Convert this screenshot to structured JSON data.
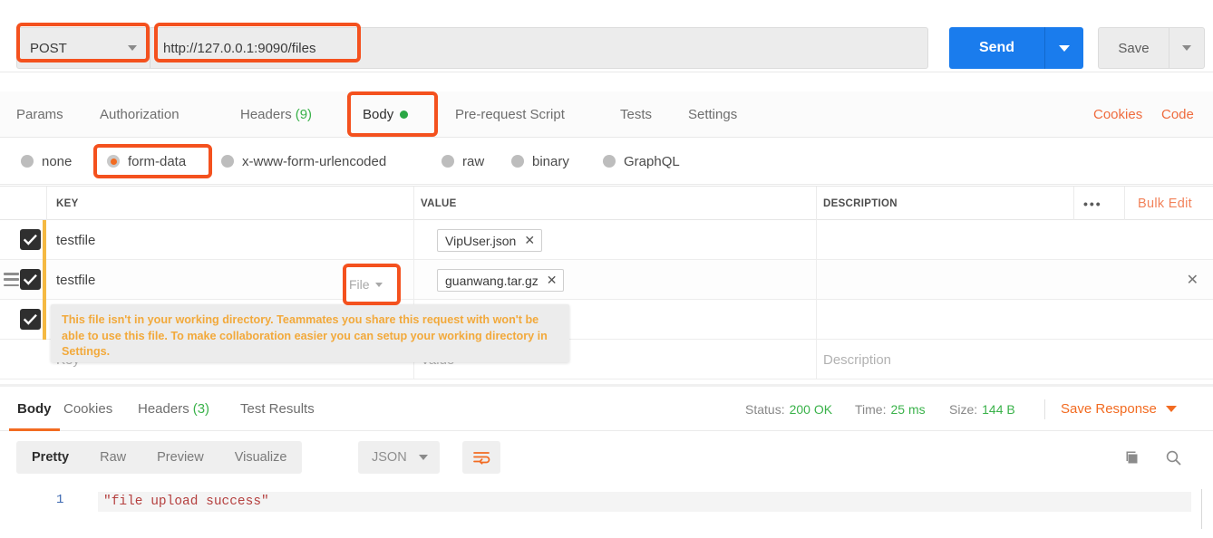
{
  "request": {
    "method": "POST",
    "url": "http://127.0.0.1:9090/files",
    "send_label": "Send",
    "save_label": "Save",
    "tabs": [
      {
        "label": "Params",
        "count": "",
        "active": false,
        "dot": false
      },
      {
        "label": "Authorization",
        "count": "",
        "active": false,
        "dot": false
      },
      {
        "label": "Headers",
        "count": "(9)",
        "active": false,
        "dot": false
      },
      {
        "label": "Body",
        "count": "",
        "active": true,
        "dot": true
      },
      {
        "label": "Pre-request Script",
        "count": "",
        "active": false,
        "dot": false
      },
      {
        "label": "Tests",
        "count": "",
        "active": false,
        "dot": false
      },
      {
        "label": "Settings",
        "count": "",
        "active": false,
        "dot": false
      }
    ],
    "cookies_label": "Cookies",
    "code_label": "Code",
    "body_types": [
      {
        "label": "none",
        "selected": false
      },
      {
        "label": "form-data",
        "selected": true
      },
      {
        "label": "x-www-form-urlencoded",
        "selected": false
      },
      {
        "label": "raw",
        "selected": false
      },
      {
        "label": "binary",
        "selected": false
      },
      {
        "label": "GraphQL",
        "selected": false
      }
    ]
  },
  "table": {
    "headers": {
      "key": "KEY",
      "value": "VALUE",
      "description": "DESCRIPTION",
      "more": "•••",
      "bulk_edit": "Bulk Edit"
    },
    "rows": [
      {
        "checked": true,
        "key": "testfile",
        "type_label": "",
        "chip": "VipUser.json",
        "chip_close": "✕",
        "description": "",
        "show_delete": false,
        "show_drag": false
      },
      {
        "checked": true,
        "key": "testfile",
        "type_label": "File",
        "chip": "guanwang.tar.gz",
        "chip_close": "✕",
        "description": "",
        "show_delete": true,
        "show_drag": true
      },
      {
        "checked": true,
        "key": "",
        "type_label": "",
        "chip": "",
        "chip_close": "",
        "description": "",
        "show_delete": false,
        "show_drag": false
      }
    ],
    "placeholder_row": {
      "key": "Key",
      "value": "Value",
      "description": "Description"
    }
  },
  "tooltip": {
    "text": "This file isn't in your working directory. Teammates you share this request with won't be able to use this file. To make collaboration easier you can setup your working directory in Settings."
  },
  "response": {
    "tabs": [
      {
        "label": "Body",
        "count": "",
        "active": true
      },
      {
        "label": "Cookies",
        "count": "",
        "active": false
      },
      {
        "label": "Headers",
        "count": "(3)",
        "active": false
      },
      {
        "label": "Test Results",
        "count": "",
        "active": false
      }
    ],
    "status_label": "Status:",
    "status_value": "200 OK",
    "time_label": "Time:",
    "time_value": "25 ms",
    "size_label": "Size:",
    "size_value": "144 B",
    "save_response": "Save Response",
    "format_tabs": [
      {
        "label": "Pretty",
        "active": true
      },
      {
        "label": "Raw",
        "active": false
      },
      {
        "label": "Preview",
        "active": false
      },
      {
        "label": "Visualize",
        "active": false
      }
    ],
    "language": "JSON",
    "body_lines": [
      {
        "number": "1",
        "text": "\"file upload success\""
      }
    ]
  },
  "colors": {
    "accent_orange": "#f26b21",
    "annotation": "#f4511e",
    "send_blue": "#1a7ced",
    "success_green": "#3ab24a",
    "warning_yellow": "#f2a93b"
  }
}
